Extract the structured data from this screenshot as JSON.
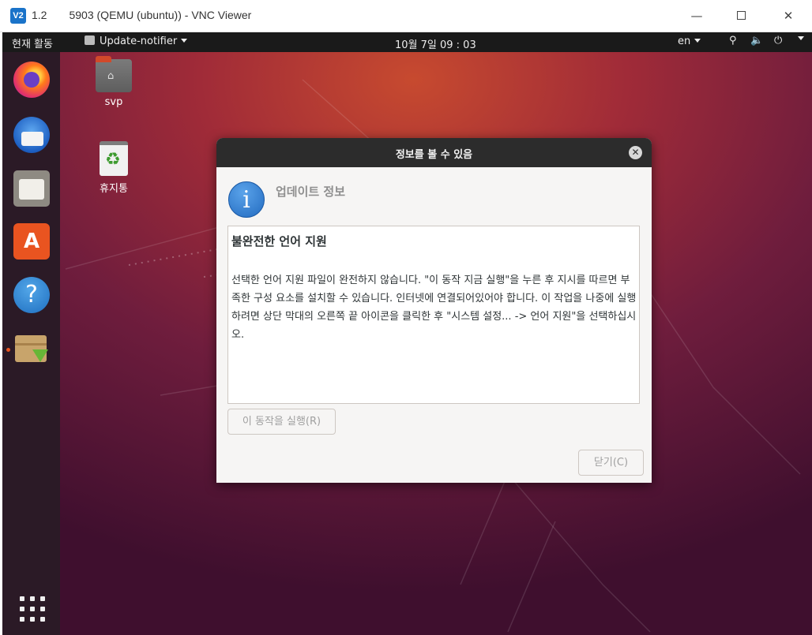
{
  "vnc": {
    "logo": "V2",
    "title": "1.2          5903 (QEMU (ubuntu)) - VNC Viewer",
    "minimize": "—",
    "close": "✕"
  },
  "topbar": {
    "activities": "현재 활동",
    "app_name": "Update-notifier",
    "clock": "10월 7일  09 : 03",
    "lang": "en"
  },
  "desktop_icons": {
    "home": "svp",
    "home_glyph": "⌂",
    "trash": "휴지통",
    "trash_glyph": "♻"
  },
  "dock": {
    "software_glyph": "A",
    "help_glyph": "?"
  },
  "dialog": {
    "title": "정보를 볼 수 있음",
    "close_glyph": "✕",
    "info_glyph": "i",
    "heading": "업데이트 정보",
    "message_heading": "불완전한 언어 지원",
    "message_body": "선택한 언어 지원 파일이 완전하지 않습니다. \"이 동작 지금 실행\"을 누른 후 지시를 따르면 부족한 구성 요소를 설치할 수 있습니다. 인터넷에 연결되어있어야 합니다. 이 작업을 나중에 실행하려면 상단 막대의 오른쪽 끝 아이콘을 클릭한 후 \"시스템 설정... -> 언어 지원\"을 선택하십시오.",
    "run_button": "이 동작을 실행(R)",
    "close_button": "닫기(C)"
  },
  "colors": {
    "ubuntu_orange": "#e95420",
    "topbar": "#1a1a1a",
    "dialog_header": "#2c2c2c",
    "dialog_bg": "#f6f5f4"
  },
  "icons": [
    "firefox-icon",
    "thunderbird-icon",
    "files-icon",
    "software-icon",
    "help-icon",
    "software-updater-icon",
    "show-apps-icon",
    "network-icon",
    "volume-icon",
    "power-icon"
  ]
}
